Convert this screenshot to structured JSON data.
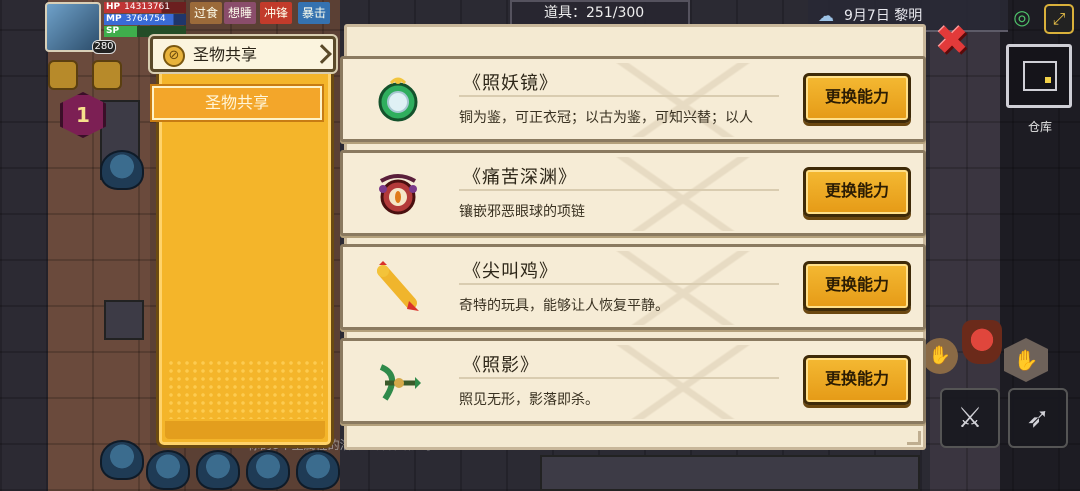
{
  "hud": {
    "level": "280",
    "hp_label": "HP",
    "hp_value": "14313761",
    "mp_label": "MP",
    "mp_value": "3764754",
    "sp_label": "SP",
    "status_tabs": [
      "过食",
      "想睡",
      "冲锋",
      "暴击"
    ],
    "items_label": "道具：251/300",
    "date": "9月7日  黎明",
    "warehouse_label": "仓库",
    "quest_level": "1"
  },
  "panel": {
    "main_tab": "圣物共享",
    "sub_tab": "圣物共享"
  },
  "relics": [
    {
      "name": "《照妖镜》",
      "description": "铜为鉴，可正衣冠；以古为鉴，可知兴替；以人",
      "button": "更换能力",
      "icon": "jade-mirror-icon"
    },
    {
      "name": "《痛苦深渊》",
      "description": "镶嵌邪恶眼球的项链",
      "button": "更换能力",
      "icon": "evil-eye-necklace-icon"
    },
    {
      "name": "《尖叫鸡》",
      "description": "奇特的玩具，能够让人恢复平静。",
      "button": "更换能力",
      "icon": "rubber-chicken-icon"
    },
    {
      "name": "《照影》",
      "description": "照见无形，影落即杀。",
      "button": "更换能力",
      "icon": "green-crossbow-icon"
    }
  ],
  "background_message": "你的8个生属性的潜力全部都增加了。",
  "colors": {
    "panel_yellow": "#f4b52a",
    "button_gold": "#f0ad24",
    "card_cream": "#f4ead2",
    "close_red": "#e23a3a"
  }
}
